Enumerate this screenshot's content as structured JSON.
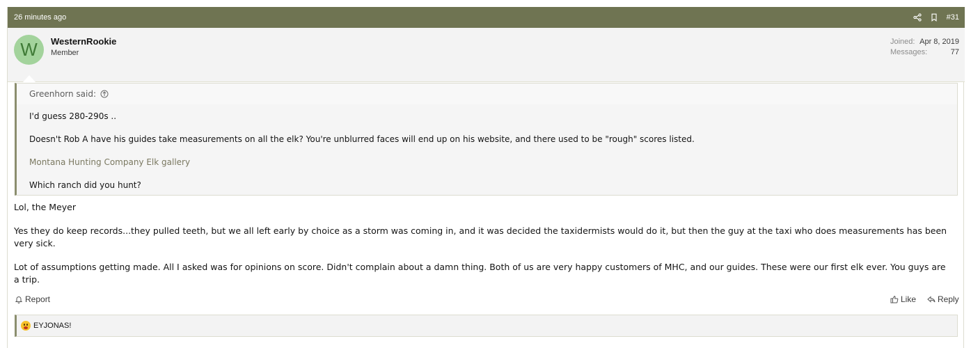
{
  "header": {
    "timestamp": "26 minutes ago",
    "post_number": "#31",
    "share_icon": "share-icon",
    "bookmark_icon": "bookmark-icon",
    "bar_color": "#6f7452"
  },
  "user": {
    "avatar_letter": "W",
    "avatar_color": "#a3d39c",
    "name": "WesternRookie",
    "title": "Member",
    "joined_label": "Joined:",
    "joined_value": "Apr 8, 2019",
    "messages_label": "Messages:",
    "messages_value": "77"
  },
  "quote": {
    "author": "Greenhorn said:",
    "line1": "I'd guess 280-290s ..",
    "line2": "Doesn't Rob A have his guides take measurements on all the elk? You're unblurred faces will end up on his website, and there used to be \"rough\" scores listed.",
    "link": "Montana Hunting Company Elk gallery",
    "line3": "Which ranch did you hunt?"
  },
  "message": {
    "p1": "Lol, the Meyer",
    "p2": "Yes they do keep records...they pulled teeth, but we all left early by choice as a storm was coming in, and it was decided the taxidermists would do it, but then the guy at the taxi who does measurements has been very sick.",
    "p3": "Lot of assumptions getting made. All I asked was for opinions on score. Didn't complain about a damn thing. Both of us are very happy customers of MHC, and our guides. These were our first elk ever. You guys are a trip."
  },
  "actions": {
    "report": "Report",
    "like": "Like",
    "reply": "Reply"
  },
  "reactions": {
    "emoji": "wow-emoji",
    "users": "EYJONAS!"
  }
}
